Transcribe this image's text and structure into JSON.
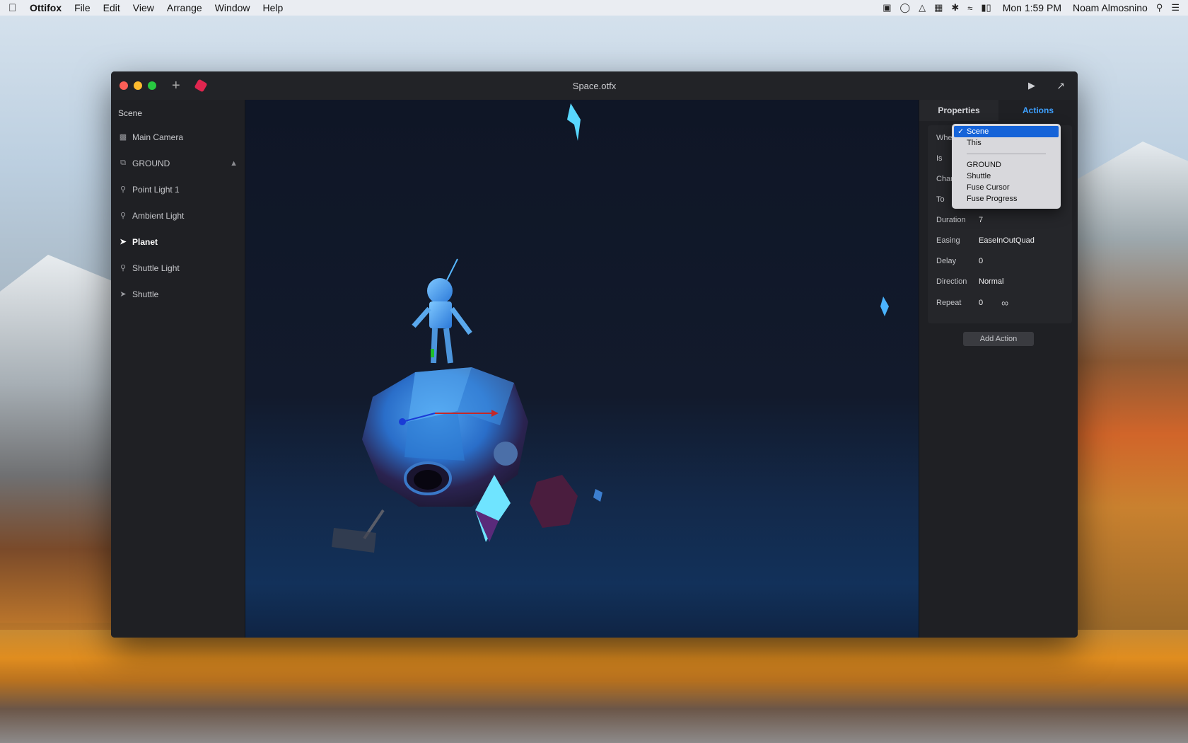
{
  "menubar": {
    "app_name": "Ottifox",
    "menus": [
      "File",
      "Edit",
      "View",
      "Arrange",
      "Window",
      "Help"
    ],
    "clock": "Mon 1:59 PM",
    "user": "Noam Almosnino"
  },
  "window": {
    "title": "Space.otfx"
  },
  "sidebar": {
    "heading": "Scene",
    "items": [
      {
        "label": "Main Camera",
        "icon": "camera-icon"
      },
      {
        "label": "GROUND",
        "icon": "group-icon",
        "locked": true
      },
      {
        "label": "Point Light 1",
        "icon": "bulb-icon"
      },
      {
        "label": "Ambient Light",
        "icon": "bulb-icon"
      },
      {
        "label": "Planet",
        "icon": "object-icon",
        "selected": true
      },
      {
        "label": "Shuttle Light",
        "icon": "bulb-icon"
      },
      {
        "label": "Shuttle",
        "icon": "object-icon"
      }
    ]
  },
  "inspector": {
    "tabs": [
      "Properties",
      "Actions"
    ],
    "active_tab": "Actions",
    "fields": {
      "when_label": "When",
      "is_label": "Is",
      "change_label": "Change",
      "to_label": "To",
      "duration_label": "Duration",
      "duration_value": "7",
      "easing_label": "Easing",
      "easing_value": "EaseInOutQuad",
      "delay_label": "Delay",
      "delay_value": "0",
      "direction_label": "Direction",
      "direction_value": "Normal",
      "repeat_label": "Repeat",
      "repeat_value": "0",
      "repeat_infinite_symbol": "∞"
    },
    "add_action_label": "Add Action"
  },
  "dropdown": {
    "selected": "Scene",
    "group1": [
      "Scene",
      "This"
    ],
    "group2": [
      "GROUND",
      "Shuttle",
      "Fuse Cursor",
      "Fuse Progress"
    ]
  },
  "colors": {
    "accent": "#3ea0ff",
    "selection": "#1563d8",
    "viewport_bg": "#0f1626"
  }
}
